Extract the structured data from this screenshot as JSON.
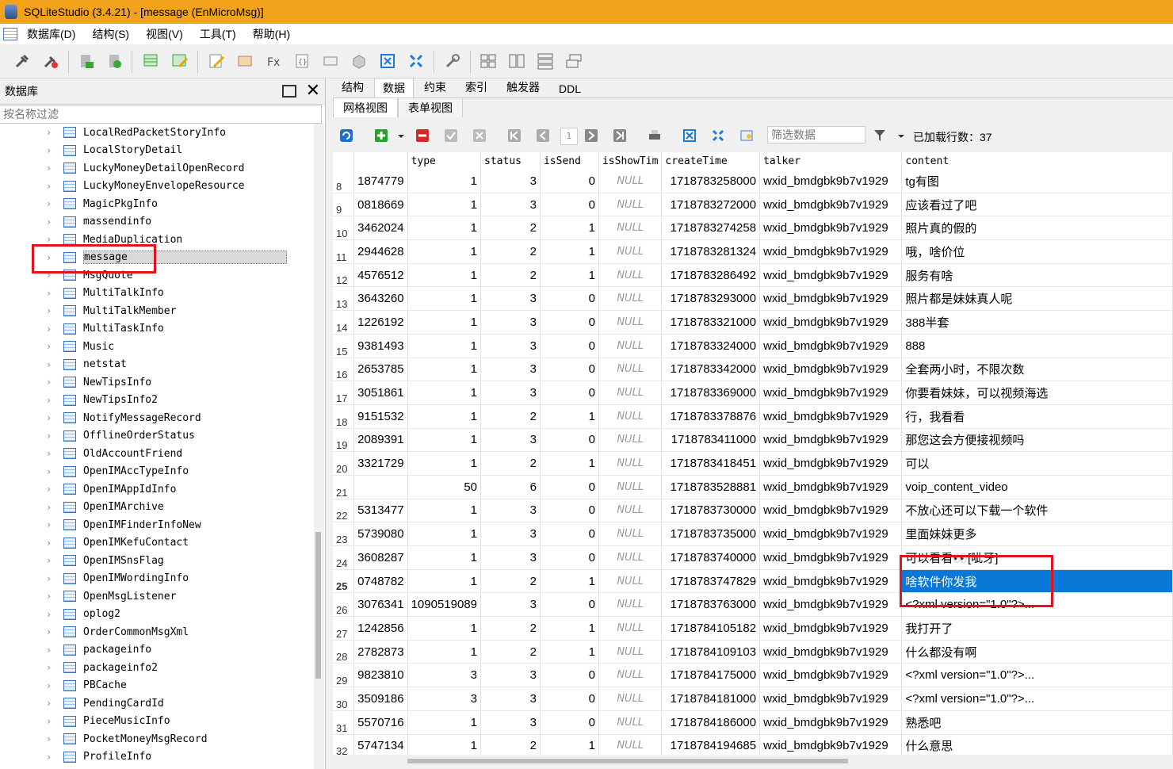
{
  "window": {
    "title": "SQLiteStudio (3.4.21) - [message (EnMicroMsg)]"
  },
  "menu": [
    "数据库(D)",
    "结构(S)",
    "视图(V)",
    "工具(T)",
    "帮助(H)"
  ],
  "left_panel": {
    "title": "数据库",
    "filter_placeholder": "按名称过滤",
    "items": [
      "LocalRedPacketStoryInfo",
      "LocalStoryDetail",
      "LuckyMoneyDetailOpenRecord",
      "LuckyMoneyEnvelopeResource",
      "MagicPkgInfo",
      "massendinfo",
      "MediaDuplication",
      "message",
      "MsgQuote",
      "MultiTalkInfo",
      "MultiTalkMember",
      "MultiTaskInfo",
      "Music",
      "netstat",
      "NewTipsInfo",
      "NewTipsInfo2",
      "NotifyMessageRecord",
      "OfflineOrderStatus",
      "OldAccountFriend",
      "OpenIMAccTypeInfo",
      "OpenIMAppIdInfo",
      "OpenIMArchive",
      "OpenIMFinderInfoNew",
      "OpenIMKefuContact",
      "OpenIMSnsFlag",
      "OpenIMWordingInfo",
      "OpenMsgListener",
      "oplog2",
      "OrderCommonMsgXml",
      "packageinfo",
      "packageinfo2",
      "PBCache",
      "PendingCardId",
      "PieceMusicInfo",
      "PocketMoneyMsgRecord",
      "ProfileInfo"
    ],
    "selected": "message"
  },
  "tabs": [
    "结构",
    "数据",
    "约束",
    "索引",
    "触发器",
    "DDL"
  ],
  "active_tab": "数据",
  "subtabs": [
    "网格视图",
    "表单视图"
  ],
  "grid_toolbar": {
    "page": "1",
    "filter_placeholder": "筛选数据",
    "loaded_rows": "已加载行数：37"
  },
  "columns": [
    "",
    "",
    "type",
    "status",
    "isSend",
    "isShowTim",
    "createTime",
    "talker",
    "content"
  ],
  "null_text": "NULL",
  "rows": [
    [
      "8",
      "1874779",
      "1",
      "3",
      "0",
      "NULL",
      "1718783258000",
      "wxid_bmdgbk9b7v1929",
      "tg有图"
    ],
    [
      "9",
      "0818669",
      "1",
      "3",
      "0",
      "NULL",
      "1718783272000",
      "wxid_bmdgbk9b7v1929",
      "应该看过了吧"
    ],
    [
      "10",
      "3462024",
      "1",
      "2",
      "1",
      "NULL",
      "1718783274258",
      "wxid_bmdgbk9b7v1929",
      "照片真的假的"
    ],
    [
      "11",
      "2944628",
      "1",
      "2",
      "1",
      "NULL",
      "1718783281324",
      "wxid_bmdgbk9b7v1929",
      "哦，啥价位"
    ],
    [
      "12",
      "4576512",
      "1",
      "2",
      "1",
      "NULL",
      "1718783286492",
      "wxid_bmdgbk9b7v1929",
      "服务有啥"
    ],
    [
      "13",
      "3643260",
      "1",
      "3",
      "0",
      "NULL",
      "1718783293000",
      "wxid_bmdgbk9b7v1929",
      "照片都是妹妹真人呢"
    ],
    [
      "14",
      "1226192",
      "1",
      "3",
      "0",
      "NULL",
      "1718783321000",
      "wxid_bmdgbk9b7v1929",
      "388半套"
    ],
    [
      "15",
      "9381493",
      "1",
      "3",
      "0",
      "NULL",
      "1718783324000",
      "wxid_bmdgbk9b7v1929",
      "888"
    ],
    [
      "16",
      "2653785",
      "1",
      "3",
      "0",
      "NULL",
      "1718783342000",
      "wxid_bmdgbk9b7v1929",
      "全套两小时，不限次数"
    ],
    [
      "17",
      "3051861",
      "1",
      "3",
      "0",
      "NULL",
      "1718783369000",
      "wxid_bmdgbk9b7v1929",
      "你要看妹妹，可以视频海选"
    ],
    [
      "18",
      "9151532",
      "1",
      "2",
      "1",
      "NULL",
      "1718783378876",
      "wxid_bmdgbk9b7v1929",
      "行，我看看"
    ],
    [
      "19",
      "2089391",
      "1",
      "3",
      "0",
      "NULL",
      "1718783411000",
      "wxid_bmdgbk9b7v1929",
      "那您这会方便接视频吗"
    ],
    [
      "20",
      "3321729",
      "1",
      "2",
      "1",
      "NULL",
      "1718783418451",
      "wxid_bmdgbk9b7v1929",
      "可以"
    ],
    [
      "21",
      "",
      "50",
      "6",
      "0",
      "NULL",
      "1718783528881",
      "wxid_bmdgbk9b7v1929",
      "voip_content_video"
    ],
    [
      "22",
      "5313477",
      "1",
      "3",
      "0",
      "NULL",
      "1718783730000",
      "wxid_bmdgbk9b7v1929",
      "不放心还可以下载一个软件"
    ],
    [
      "23",
      "5739080",
      "1",
      "3",
      "0",
      "NULL",
      "1718783735000",
      "wxid_bmdgbk9b7v1929",
      "里面妹妹更多"
    ],
    [
      "24",
      "3608287",
      "1",
      "3",
      "0",
      "NULL",
      "1718783740000",
      "wxid_bmdgbk9b7v1929",
      "可以看看👀[呲牙]"
    ],
    [
      "25",
      "0748782",
      "1",
      "2",
      "1",
      "NULL",
      "1718783747829",
      "wxid_bmdgbk9b7v1929",
      "啥软件你发我"
    ],
    [
      "26",
      "3076341",
      "1090519089",
      "3",
      "0",
      "NULL",
      "1718783763000",
      "wxid_bmdgbk9b7v1929",
      "<?xml version=\"1.0\"?>..."
    ],
    [
      "27",
      "1242856",
      "1",
      "2",
      "1",
      "NULL",
      "1718784105182",
      "wxid_bmdgbk9b7v1929",
      "我打开了"
    ],
    [
      "28",
      "2782873",
      "1",
      "2",
      "1",
      "NULL",
      "1718784109103",
      "wxid_bmdgbk9b7v1929",
      "什么都没有啊"
    ],
    [
      "29",
      "9823810",
      "3",
      "3",
      "0",
      "NULL",
      "1718784175000",
      "wxid_bmdgbk9b7v1929",
      "<?xml version=\"1.0\"?>..."
    ],
    [
      "30",
      "3509186",
      "3",
      "3",
      "0",
      "NULL",
      "1718784181000",
      "wxid_bmdgbk9b7v1929",
      "<?xml version=\"1.0\"?>..."
    ],
    [
      "31",
      "5570716",
      "1",
      "3",
      "0",
      "NULL",
      "1718784186000",
      "wxid_bmdgbk9b7v1929",
      "熟悉吧"
    ],
    [
      "32",
      "5747134",
      "1",
      "2",
      "1",
      "NULL",
      "1718784194685",
      "wxid_bmdgbk9b7v1929",
      "什么意思"
    ]
  ],
  "selected_row": "25",
  "colors": {
    "title_bar": "#f3a21b",
    "selection": "#0a78d7",
    "annotation": "#e0141e"
  }
}
